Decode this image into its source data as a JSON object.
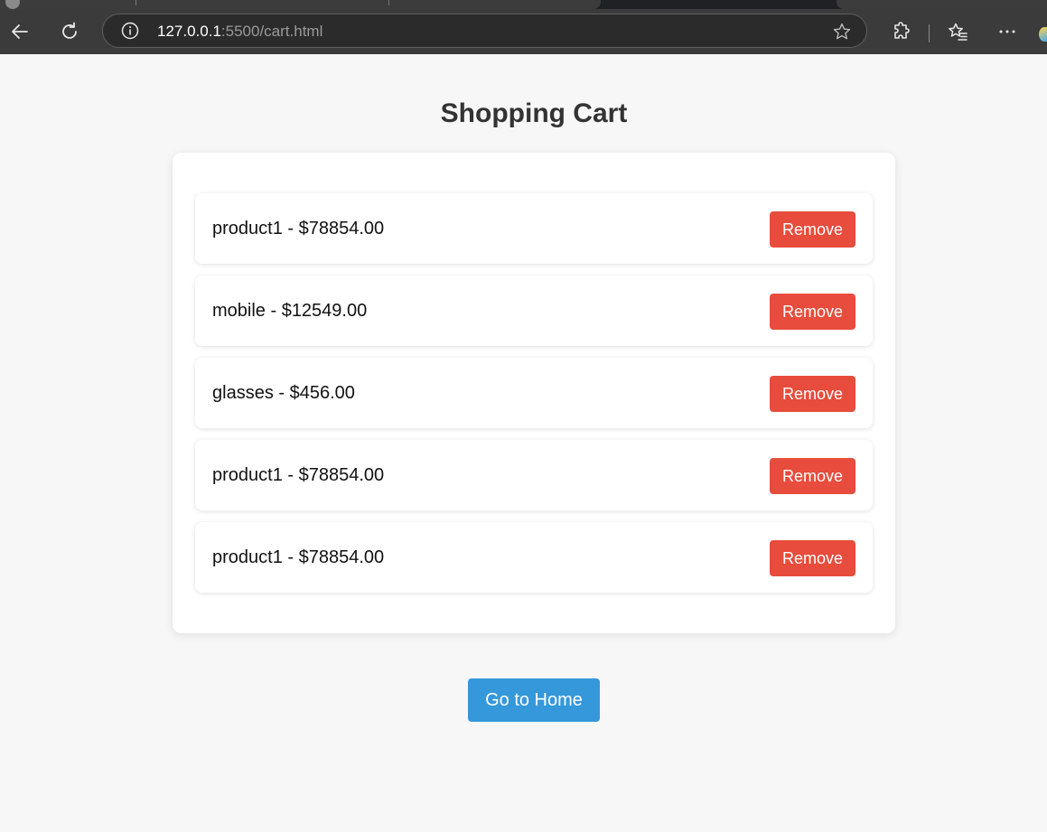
{
  "browser": {
    "url_host": "127.0.0.1",
    "url_path": ":5500/cart.html",
    "icons": {
      "back": "back-arrow-icon",
      "refresh": "refresh-icon",
      "info": "info-icon",
      "favorite": "star-icon",
      "extensions": "extensions-icon",
      "favorites_list": "favorites-list-icon",
      "menu": "more-menu-icon"
    }
  },
  "page": {
    "title": "Shopping Cart",
    "home_button_label": "Go to Home"
  },
  "cart": {
    "items": [
      {
        "label": "product1 - $78854.00",
        "remove_label": "Remove"
      },
      {
        "label": "mobile - $12549.00",
        "remove_label": "Remove"
      },
      {
        "label": "glasses - $456.00",
        "remove_label": "Remove"
      },
      {
        "label": "product1 - $78854.00",
        "remove_label": "Remove"
      },
      {
        "label": "product1 - $78854.00",
        "remove_label": "Remove"
      }
    ]
  },
  "colors": {
    "remove_button": "#e74c3c",
    "home_button": "#3498db",
    "page_background": "#f7f7f7",
    "title_text": "#333333"
  }
}
